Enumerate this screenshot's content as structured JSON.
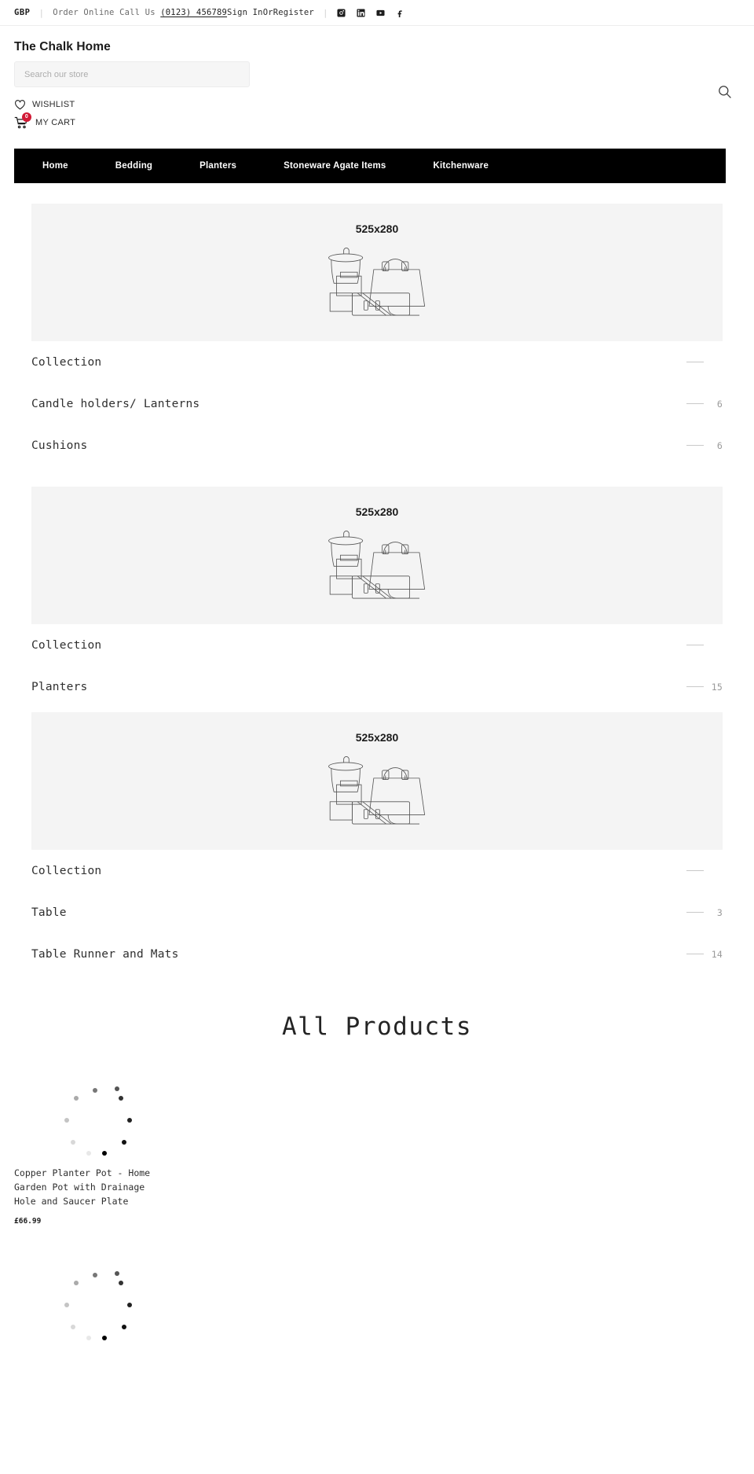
{
  "topbar": {
    "currency": "GBP",
    "order_text": "Order Online Call Us",
    "phone": "(0123) 456789",
    "sign_in": "Sign In",
    "or": "Or",
    "register": "Register",
    "social": [
      {
        "name": "instagram-icon",
        "label": "Instagram"
      },
      {
        "name": "linkedin-icon",
        "label": "LinkedIn"
      },
      {
        "name": "youtube-icon",
        "label": "YouTube"
      },
      {
        "name": "facebook-icon",
        "label": "Facebook"
      }
    ]
  },
  "header": {
    "brand": "The Chalk Home",
    "search_placeholder": "Search our store",
    "search_value": "",
    "wishlist_label": "WISHLIST",
    "cart_label": "MY CART",
    "cart_count": "0",
    "cart_badge_color": "#d11935"
  },
  "nav": {
    "items": [
      {
        "label": "Home"
      },
      {
        "label": "Bedding"
      },
      {
        "label": "Planters"
      },
      {
        "label": "Stoneware Agate Items"
      },
      {
        "label": "Kitchenware"
      }
    ]
  },
  "placeholder": {
    "size_label": "525x280"
  },
  "collections": [
    {
      "label": "Collection",
      "count": ""
    },
    {
      "label": "Candle holders/ Lanterns",
      "count": "6"
    },
    {
      "label": "Cushions",
      "count": "6"
    },
    {
      "label": "Collection",
      "count": ""
    },
    {
      "label": "Planters",
      "count": "15"
    },
    {
      "label": "Collection",
      "count": ""
    },
    {
      "label": "Table",
      "count": "3"
    },
    {
      "label": "Table Runner and Mats",
      "count": "14"
    }
  ],
  "all_products": {
    "heading": "All Products",
    "items": [
      {
        "title": "Copper Planter Pot - Home Garden Pot with Drainage Hole and Saucer Plate",
        "price": "£66.99"
      },
      {
        "title": "",
        "price": ""
      }
    ]
  }
}
